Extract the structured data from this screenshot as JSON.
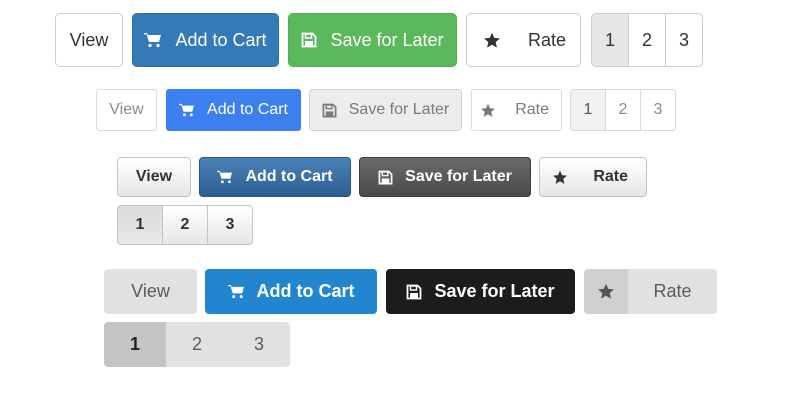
{
  "rows": [
    {
      "view_label": "View",
      "add_to_cart_label": "Add to Cart",
      "save_for_later_label": "Save for Later",
      "rate_label": "Rate",
      "pages": [
        "1",
        "2",
        "3"
      ],
      "active_page": "1"
    },
    {
      "view_label": "View",
      "add_to_cart_label": "Add to Cart",
      "save_for_later_label": "Save for Later",
      "rate_label": "Rate",
      "pages": [
        "1",
        "2",
        "3"
      ],
      "active_page": "1"
    },
    {
      "view_label": "View",
      "add_to_cart_label": "Add to Cart",
      "save_for_later_label": "Save for Later",
      "rate_label": "Rate",
      "pages": [
        "1",
        "2",
        "3"
      ],
      "active_page": "1"
    },
    {
      "view_label": "View",
      "add_to_cart_label": "Add to Cart",
      "save_for_later_label": "Save for Later",
      "rate_label": "Rate",
      "pages": [
        "1",
        "2",
        "3"
      ],
      "active_page": "1"
    }
  ],
  "icons": {
    "cart": "cart-icon",
    "save": "floppy-disk-icon",
    "rate": "star-icon"
  },
  "colors": {
    "bootstrap_primary": "#337ab7",
    "bootstrap_success": "#5cb85c",
    "material_primary": "#3b80ee",
    "gradient_primary": "#2e5f93",
    "gradient_dark": "#4a4a4a",
    "semantic_primary": "#2185d0",
    "semantic_black": "#1b1c1d",
    "semantic_grey": "#e0e1e2"
  }
}
